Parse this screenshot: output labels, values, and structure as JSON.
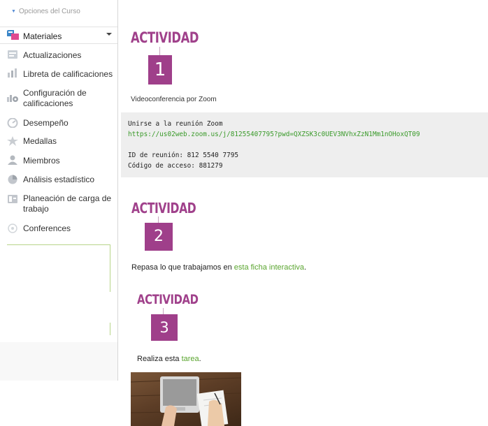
{
  "sidebar": {
    "top_item": "Opciones del Curso",
    "materials_label": "Materiales",
    "items": [
      {
        "label": "Actualizaciones",
        "icon": "updates-icon"
      },
      {
        "label": "Libreta de calificaciones",
        "icon": "gradebook-icon"
      },
      {
        "label": "Configuración de calificaciones",
        "icon": "grade-settings-icon"
      },
      {
        "label": "Desempeño",
        "icon": "performance-icon"
      },
      {
        "label": "Medallas",
        "icon": "badge-icon"
      },
      {
        "label": "Miembros",
        "icon": "members-icon"
      },
      {
        "label": "Análisis estadístico",
        "icon": "statistics-icon"
      },
      {
        "label": "Planeación de carga de trabajo",
        "icon": "workload-icon"
      },
      {
        "label": "Conferences",
        "icon": "conferences-icon"
      }
    ]
  },
  "activities": [
    {
      "title": "ACTIVIDAD",
      "number": "1"
    },
    {
      "title": "ACTIVIDAD",
      "number": "2"
    },
    {
      "title": "ACTIVIDAD",
      "number": "3"
    }
  ],
  "activity1": {
    "caption": "Videoconferencia por Zoom",
    "code_line1": "Unirse a la reunión Zoom",
    "code_url": "https://us02web.zoom.us/j/81255407795?pwd=QXZSK3c0UEV3NVhxZzN1Mm1nOHoxQT09",
    "code_meeting_id": "ID de reunión: 812 5540 7795",
    "code_access": "Código de acceso: 881279"
  },
  "activity2": {
    "text_before": "Repasa lo que trabajamos en ",
    "link": "esta ficha interactiva",
    "text_after": "."
  },
  "activity3": {
    "text_before": "Realiza esta ",
    "link": "tarea",
    "text_after": "."
  },
  "colors": {
    "accent_purple": "#9f3f8a",
    "link_green": "#5aa52f"
  }
}
